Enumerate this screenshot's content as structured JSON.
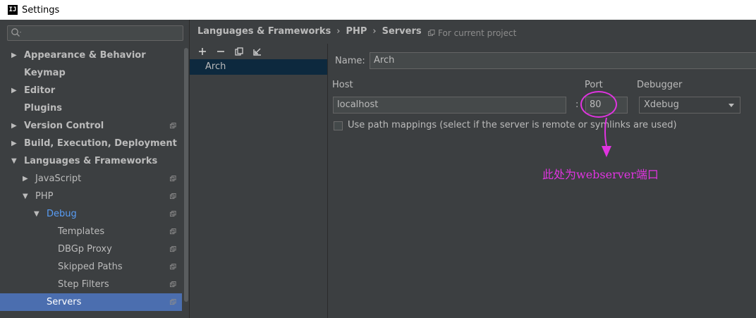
{
  "window": {
    "title": "Settings",
    "logo_text": "IJ"
  },
  "sidebar": {
    "search_placeholder": "",
    "items": [
      {
        "label": "Appearance & Behavior",
        "level": 0,
        "arrow": "right",
        "bold": true,
        "proj": false
      },
      {
        "label": "Keymap",
        "level": 0,
        "arrow": "none",
        "bold": true,
        "proj": false
      },
      {
        "label": "Editor",
        "level": 0,
        "arrow": "right",
        "bold": true,
        "proj": false
      },
      {
        "label": "Plugins",
        "level": 0,
        "arrow": "none",
        "bold": true,
        "proj": false
      },
      {
        "label": "Version Control",
        "level": 0,
        "arrow": "right",
        "bold": true,
        "proj": true
      },
      {
        "label": "Build, Execution, Deployment",
        "level": 0,
        "arrow": "right",
        "bold": true,
        "proj": false
      },
      {
        "label": "Languages & Frameworks",
        "level": 0,
        "arrow": "down",
        "bold": true,
        "proj": false
      },
      {
        "label": "JavaScript",
        "level": 1,
        "arrow": "right",
        "bold": false,
        "proj": true
      },
      {
        "label": "PHP",
        "level": 1,
        "arrow": "down",
        "bold": false,
        "proj": true
      },
      {
        "label": "Debug",
        "level": 2,
        "arrow": "down",
        "bold": false,
        "proj": true,
        "link": true
      },
      {
        "label": "Templates",
        "level": 3,
        "arrow": "none",
        "bold": false,
        "proj": true
      },
      {
        "label": "DBGp Proxy",
        "level": 3,
        "arrow": "none",
        "bold": false,
        "proj": true
      },
      {
        "label": "Skipped Paths",
        "level": 3,
        "arrow": "none",
        "bold": false,
        "proj": true
      },
      {
        "label": "Step Filters",
        "level": 3,
        "arrow": "none",
        "bold": false,
        "proj": true
      },
      {
        "label": "Servers",
        "level": 2,
        "arrow": "none",
        "bold": false,
        "proj": true,
        "selected": true
      }
    ]
  },
  "breadcrumb": [
    "Languages & Frameworks",
    "PHP",
    "Servers"
  ],
  "breadcrumb_sep": "›",
  "for_project": "For current project",
  "server_list": [
    "Arch"
  ],
  "form": {
    "name_label": "Name:",
    "name_value": "Arch",
    "host_label": "Host",
    "host_value": "localhost",
    "colon": ":",
    "port_label": "Port",
    "port_value": "80",
    "debugger_label": "Debugger",
    "debugger_value": "Xdebug",
    "path_mappings_label": "Use path mappings (select if the server is remote or symlinks are used)",
    "path_mappings_checked": false
  },
  "annotation": {
    "text": "此处为webserver端口",
    "color": "#e034e0"
  },
  "colors": {
    "background": "#3c3f41",
    "selection": "#4b6eaf",
    "list_selection": "#0d293e",
    "link": "#589df6"
  }
}
